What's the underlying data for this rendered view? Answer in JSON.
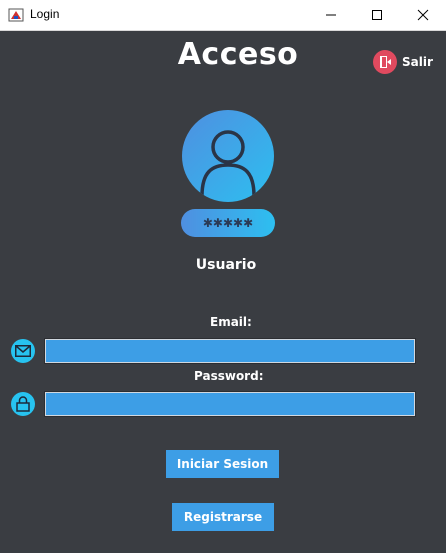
{
  "window": {
    "title": "Login"
  },
  "header": {
    "title": "Acceso",
    "exit_label": "Salir"
  },
  "profile": {
    "password_mask": "✱✱✱✱✱",
    "user_label": "Usuario"
  },
  "form": {
    "email_label": "Email:",
    "email_value": "",
    "password_label": "Password:",
    "password_value": ""
  },
  "actions": {
    "login_label": "Iniciar Sesion",
    "register_label": "Registrarse"
  },
  "colors": {
    "background": "#3a3d42",
    "accent": "#3d9ee6",
    "icon": "#27c3f0",
    "exit": "#e04a5f"
  }
}
